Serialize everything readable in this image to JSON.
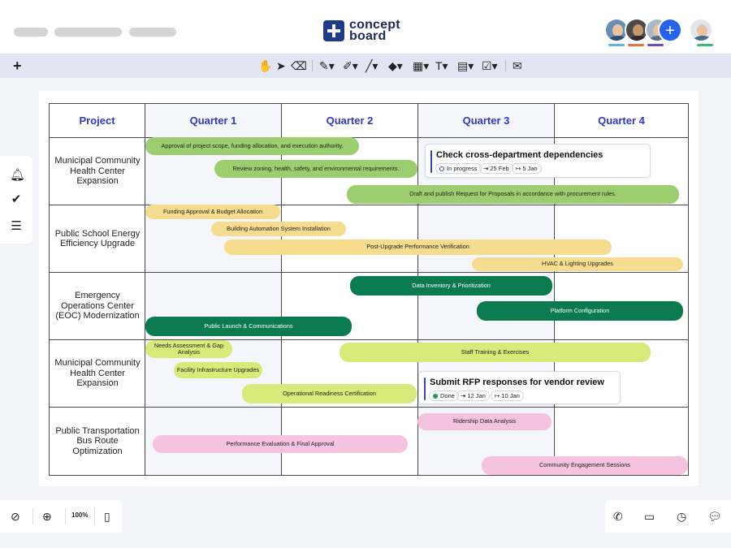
{
  "app": {
    "logo_line1": "concept",
    "logo_line2": "board",
    "brand_color": "#1e3a8a"
  },
  "toolbar": {
    "add_icon": "plus-icon",
    "tools": [
      "hand-tool-icon",
      "select-pointer-icon",
      "eraser-icon",
      "pen-tool-icon",
      "highlighter-icon",
      "line-tool-icon",
      "shapes-icon",
      "table-icon",
      "text-tool-icon",
      "sticky-note-icon",
      "task-card-icon",
      "comment-icon"
    ]
  },
  "sidebar": [
    "bell-icon",
    "check-circle-icon",
    "list-icon"
  ],
  "board": {
    "header": {
      "project": "Project",
      "quarters": [
        "Quarter 1",
        "Quarter 2",
        "Quarter 3",
        "Quarter 4"
      ]
    },
    "rows": [
      {
        "label": "Municipal Community Health Center Expansion"
      },
      {
        "label": "Public School Energy Efficiency Upgrade"
      },
      {
        "label": "Emergency Operations Center (EOC) Modernization"
      },
      {
        "label": "Municipal Community Health Center Expansion"
      },
      {
        "label": "Public Transportation Bus Route Optimization"
      }
    ],
    "bars": [
      {
        "label": "Approval of project scope, funding allocation, and execution authority.",
        "color": "#9ccd6e"
      },
      {
        "label": "Review zoning, health, safety, and environmental requirements.",
        "color": "#9ccd6e"
      },
      {
        "label": "Draft and publish Request for Proposals in accordance with procurement rules.",
        "color": "#9ccd6e"
      },
      {
        "label": "Funding Approval & Budget Allocation",
        "color": "#f6dc8e"
      },
      {
        "label": "Building Automation System Installation",
        "color": "#f6dc8e"
      },
      {
        "label": "Post-Upgrade Performance Verification",
        "color": "#f6dc8e"
      },
      {
        "label": "HVAC & Lighting Upgrades",
        "color": "#f6dc8e"
      },
      {
        "label": "Data Inventory & Prioritization",
        "color": "#0b7a4e"
      },
      {
        "label": "Platform Configuration",
        "color": "#0b7a4e"
      },
      {
        "label": "Public Launch & Communications",
        "color": "#0b7a4e"
      },
      {
        "label": "Needs Assessment & Gap Analysis",
        "color": "#d8ea7a"
      },
      {
        "label": "Staff Training & Exercises",
        "color": "#d8ea7a"
      },
      {
        "label": "Facility Infrastructure Upgrades",
        "color": "#d8ea7a"
      },
      {
        "label": "Operational Readiness Certification",
        "color": "#d8ea7a"
      },
      {
        "label": "Ridership Data Analysis",
        "color": "#f5c2e0"
      },
      {
        "label": "Performance Evaluation & Final Approval",
        "color": "#f5c2e0"
      },
      {
        "label": "Community Engagement Sessions",
        "color": "#f5c2e0"
      }
    ],
    "cards": [
      {
        "title": "Check cross-department dependencies",
        "status": "In progress",
        "start": "25 Feb",
        "end": "5 Jan",
        "accent": "#3b3fb8"
      },
      {
        "title": "Submit RFP responses for vendor review",
        "status": "Done",
        "start": "12 Jan",
        "end": "10 Jan",
        "accent": "#3b3fb8"
      }
    ]
  },
  "bottom": {
    "zoom": "100%",
    "left_icons": [
      "compass-icon",
      "zoom-in-icon",
      "mouse-icon"
    ],
    "right_icons": [
      "phone-icon",
      "presentation-icon",
      "timer-icon",
      "chat-icon"
    ]
  }
}
